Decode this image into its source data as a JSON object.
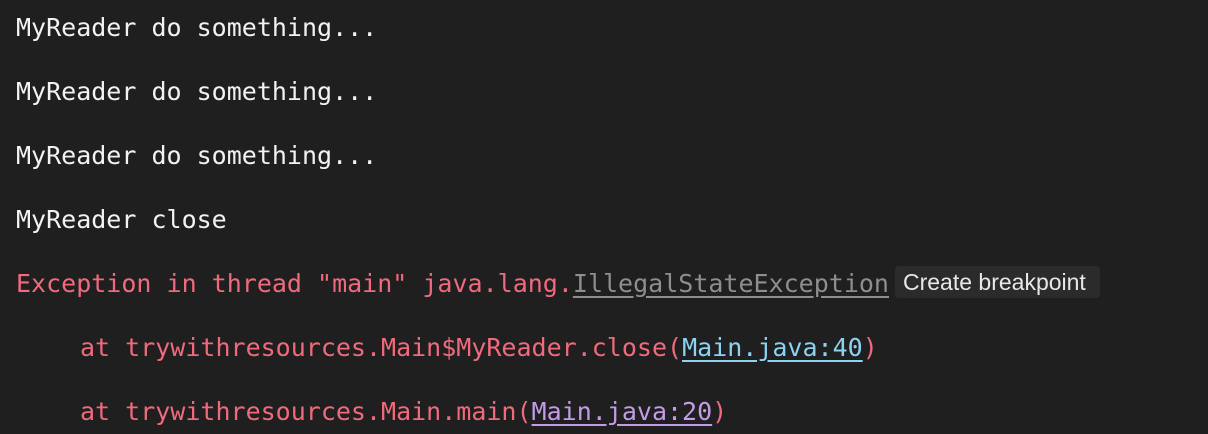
{
  "console": {
    "lines": [
      "MyReader do something...",
      "MyReader do something...",
      "MyReader do something...",
      "MyReader close"
    ],
    "exception": {
      "prefix": "Exception in thread \"main\" java.lang.",
      "class_link": "IllegalStateException",
      "breakpoint_label": "Create breakpoint"
    },
    "stack": [
      {
        "prefix": "at trywithresources.Main$MyReader.close(",
        "link": "Main.java:40",
        "suffix": ")"
      },
      {
        "prefix": "at trywithresources.Main.main(",
        "link": "Main.java:20",
        "suffix": ")"
      }
    ],
    "colors": {
      "background": "#1f1f1f",
      "text": "#f2f2f2",
      "error": "#f06a7d",
      "link_unvisited": "#8cd3f2",
      "link_visited": "#c39be6",
      "muted": "#8e8e8e"
    }
  }
}
